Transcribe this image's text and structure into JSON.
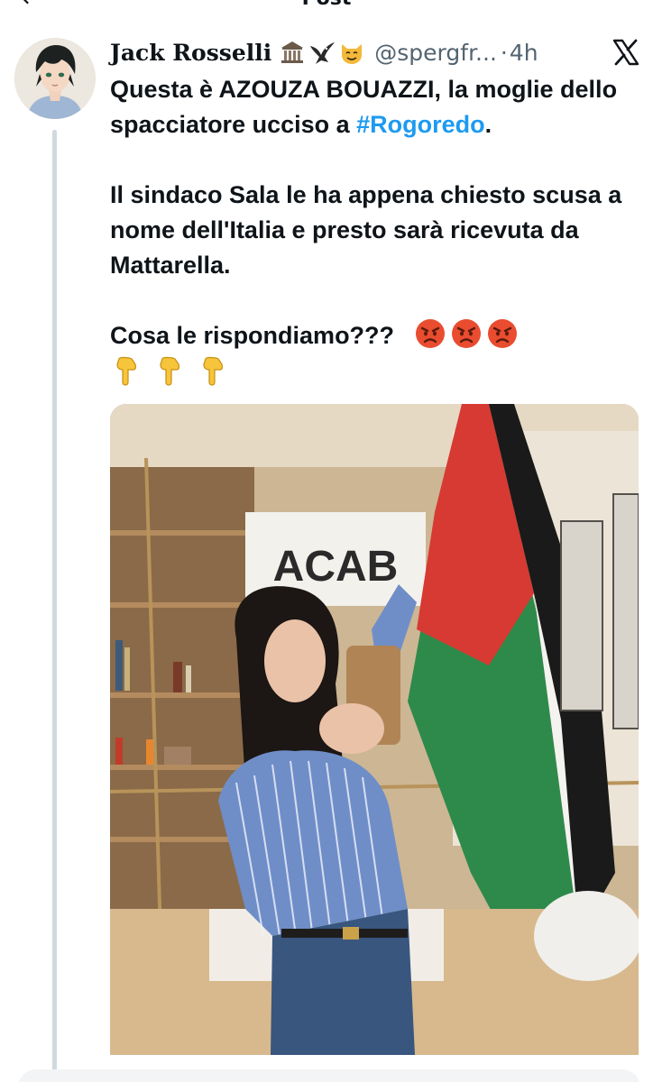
{
  "nav": {
    "title": "Post",
    "back_icon": "arrow-left-icon"
  },
  "post": {
    "author": {
      "display_name": "Jack Rosselli",
      "name_emojis": [
        "classical-building-icon",
        "eagle-icon",
        "smiling-cat-icon"
      ],
      "handle": "@spergfr...",
      "separator": "·",
      "time": "4h",
      "avatar_icon": "anime-avatar-icon"
    },
    "platform_icon": "x-logo-icon",
    "text": {
      "line1_prefix": "Questa è AZOUZA BOUAZZI, la moglie dello spacciatore ucciso a ",
      "line1_hashtag": "#Rogoredo",
      "line1_suffix": ".",
      "paragraph2": "Il sindaco Sala le ha appena chiesto scusa a nome dell'Italia e presto sarà ricevuta da Mattarella.",
      "paragraph3": "Cosa le rispondiamo???",
      "angry_emojis": [
        "angry-face-icon",
        "angry-face-icon",
        "angry-face-icon"
      ],
      "pointing_emojis": [
        "pointing-down-icon",
        "pointing-down-icon",
        "pointing-down-icon"
      ]
    },
    "media": {
      "banner_text": "ACAB",
      "description_icon": "mirror-selfie-photo"
    }
  },
  "colors": {
    "link": "#1d9bf0",
    "text": "#0f1419",
    "secondary": "#536471",
    "thread_line": "#cfd9de"
  }
}
